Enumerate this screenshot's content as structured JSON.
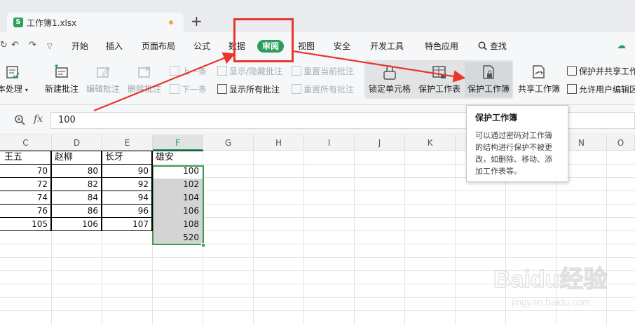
{
  "tab": {
    "title": "工作簿1.xlsx",
    "icon_letter": "S"
  },
  "menu": {
    "items": [
      "开始",
      "插入",
      "页面布局",
      "公式",
      "数据",
      "审阅",
      "视图",
      "安全",
      "开发工具",
      "特色应用"
    ],
    "active": "审阅",
    "search_label": "查找"
  },
  "ribbon": {
    "left_cut": "本处理",
    "new_comment": "新建批注",
    "edit_comment": "编辑批注",
    "delete_comment": "删除批注",
    "prev": "上一条",
    "next": "下一条",
    "show_hide": "显示/隐藏批注",
    "show_all": "显示所有批注",
    "reset_current": "重置当前批注",
    "reset_all": "重置所有批注",
    "lock_cell": "锁定单元格",
    "protect_sheet": "保护工作表",
    "protect_workbook": "保护工作簿",
    "share_workbook": "共享工作簿",
    "protect_share": "保护并共享工作",
    "allow_edit": "允许用户编辑区"
  },
  "formula_bar": {
    "fx": "fx",
    "value": "100"
  },
  "grid": {
    "columns": [
      "C",
      "D",
      "E",
      "F",
      "G",
      "H",
      "I",
      "J",
      "K",
      "L",
      "M",
      "N",
      "O"
    ],
    "selected_column": "F",
    "headers": [
      "王五",
      "赵柳",
      "长牙",
      "雄安"
    ],
    "rows": [
      [
        "70",
        "80",
        "90",
        "100"
      ],
      [
        "72",
        "82",
        "92",
        "102"
      ],
      [
        "74",
        "84",
        "94",
        "104"
      ],
      [
        "76",
        "86",
        "96",
        "106"
      ],
      [
        "105",
        "106",
        "107",
        "108"
      ],
      [
        "",
        "",
        "",
        "520"
      ]
    ]
  },
  "tooltip": {
    "title": "保护工作簿",
    "body": "可以通过密码对工作簿的结构进行保护不被更改，如删除、移动、添加工作表等。"
  },
  "watermark": {
    "brand": "Baidu经验",
    "url": "jingyan.baidu.com"
  },
  "colors": {
    "accent": "#2a9d5c",
    "annotation": "#e8362f",
    "selection_border": "#3a9a4e"
  }
}
